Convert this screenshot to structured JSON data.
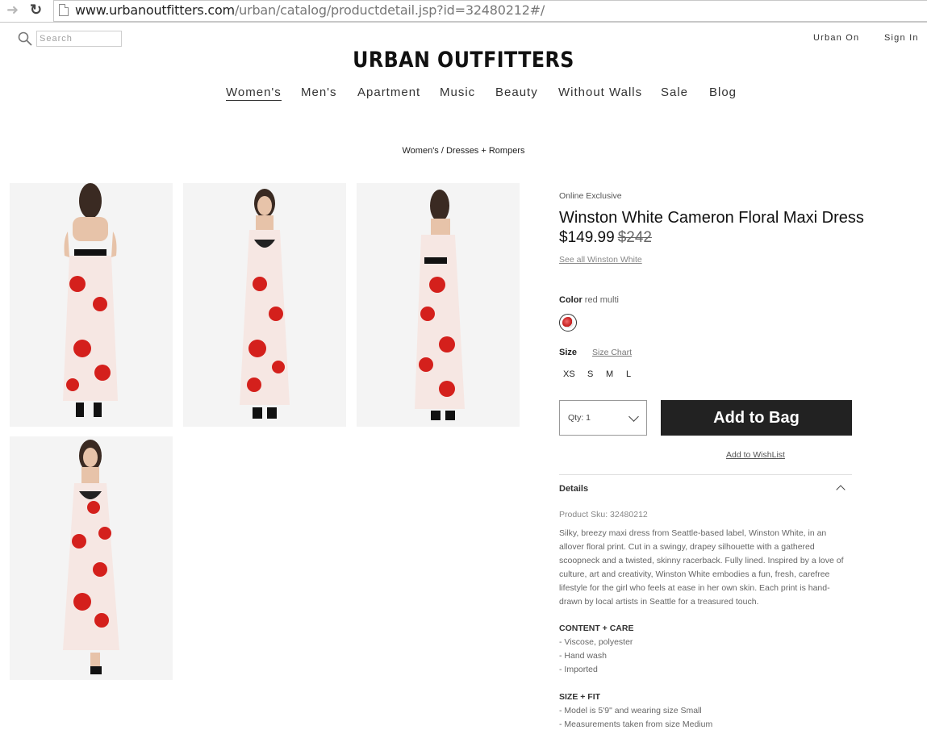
{
  "browser": {
    "url_domain": "www.urbanoutfitters.com",
    "url_path": "/urban/catalog/productdetail.jsp?id=32480212#/"
  },
  "header": {
    "search_placeholder": "Search",
    "urban_on": "Urban On",
    "sign_in": "Sign In",
    "logo": "URBAN OUTFITTERS"
  },
  "nav": {
    "items": [
      "Women's",
      "Men's",
      "Apartment",
      "Music",
      "Beauty",
      "Without Walls",
      "Sale",
      "Blog"
    ],
    "active": "Women's"
  },
  "breadcrumb": "Women's / Dresses + Rompers",
  "product": {
    "badge": "Online Exclusive",
    "title": "Winston White Cameron Floral Maxi Dress",
    "price": "$149.99",
    "original_price": "$242",
    "see_all": "See all Winston White",
    "color_label": "Color",
    "color_value": "red multi",
    "size_label": "Size",
    "size_chart": "Size Chart",
    "sizes": [
      "XS",
      "S",
      "M",
      "L"
    ],
    "qty_label": "Qty: 1",
    "add_to_bag": "Add to Bag",
    "add_to_wishlist": "Add to WishList",
    "details_heading": "Details",
    "sku": "Product Sku: 32480212",
    "description": "Silky, breezy maxi dress from Seattle-based label, Winston White, in an allover floral print. Cut in a swingy, drapey silhouette with a gathered scoopneck and a twisted, skinny racerback.  Fully lined. Inspired by a love of culture, art and creativity, Winston White embodies a fun, fresh, carefree lifestyle for the girl who feels at ease in her own skin. Each print is hand-drawn by local artists in Seattle for a treasured touch.",
    "content_care_heading": "CONTENT + CARE",
    "content_care": [
      "- Viscose, polyester",
      "- Hand wash",
      "- Imported"
    ],
    "size_fit_heading": "SIZE + FIT",
    "size_fit": [
      "- Model is 5'9\" and wearing size Small",
      "- Measurements taken from size Medium"
    ]
  },
  "colors": {
    "accent_button": "#222222",
    "flower_red": "#d4201c"
  }
}
